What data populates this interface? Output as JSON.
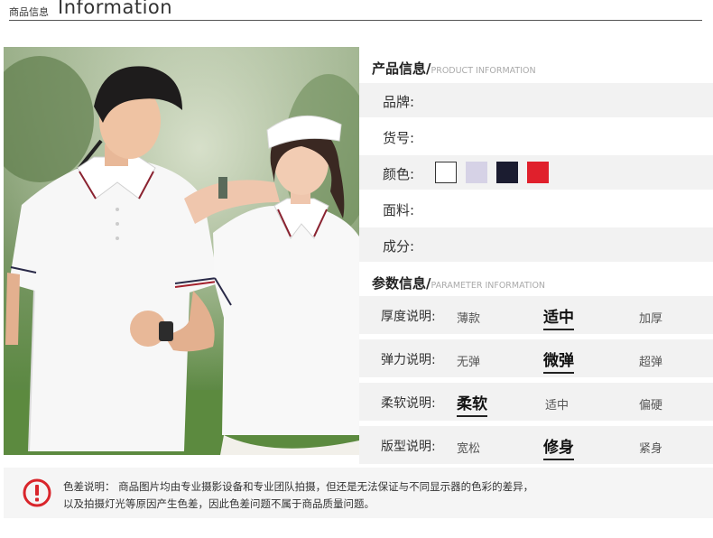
{
  "header": {
    "small_label": "商品信息",
    "big_label": "Information"
  },
  "product_info": {
    "title": "产品信息/",
    "subtitle": "PRODUCT INFORMATION",
    "rows": [
      {
        "label": "品牌:"
      },
      {
        "label": "货号:"
      },
      {
        "label": "颜色:"
      },
      {
        "label": "面料:"
      },
      {
        "label": "成分:"
      }
    ],
    "colors": [
      "#ffffff",
      "#d6d2e6",
      "#1b1c30",
      "#e0202c"
    ]
  },
  "parameter_info": {
    "title": "参数信息/",
    "subtitle": "PARAMETER INFORMATION",
    "rows": [
      {
        "label": "厚度说明:",
        "options": [
          "薄款",
          "适中",
          "加厚"
        ],
        "selected": "适中"
      },
      {
        "label": "弹力说明:",
        "options": [
          "无弹",
          "微弹",
          "超弹"
        ],
        "selected": "微弹"
      },
      {
        "label": "柔软说明:",
        "options": [
          "柔软",
          "适中",
          "偏硬"
        ],
        "selected": "柔软"
      },
      {
        "label": "版型说明:",
        "options": [
          "宽松",
          "修身",
          "紧身"
        ],
        "selected": "修身"
      }
    ]
  },
  "notice": {
    "line1": "色差说明：  商品图片均由专业摄影设备和专业团队拍摄，但还是无法保证与不同显示器的色彩的差异，",
    "line2": "以及拍摄灯光等原因产生色差，因此色差问题不属于商品质量问题。",
    "accent": "#d9252b"
  }
}
